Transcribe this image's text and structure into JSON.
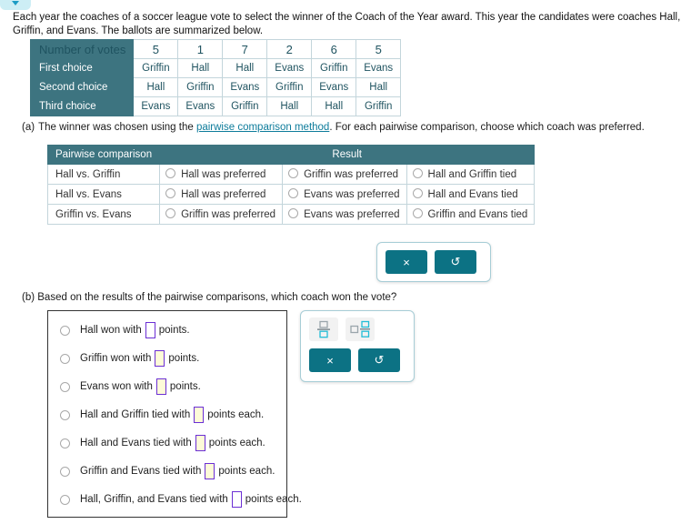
{
  "top_tab": {
    "icon": "chevron-down-icon"
  },
  "intro": "Each year the coaches of a soccer league vote to select the winner of the Coach of the Year award. This year the candidates were coaches Hall, Griffin, and Evans. The ballots are summarized below.",
  "ballot_table": {
    "rows": [
      {
        "label": "Number of votes",
        "cells": [
          "5",
          "1",
          "7",
          "2",
          "6",
          "5"
        ]
      },
      {
        "label": "First choice",
        "cells": [
          "Griffin",
          "Hall",
          "Hall",
          "Evans",
          "Griffin",
          "Evans"
        ]
      },
      {
        "label": "Second choice",
        "cells": [
          "Hall",
          "Griffin",
          "Evans",
          "Griffin",
          "Evans",
          "Hall"
        ]
      },
      {
        "label": "Third choice",
        "cells": [
          "Evans",
          "Evans",
          "Griffin",
          "Hall",
          "Hall",
          "Griffin"
        ]
      }
    ]
  },
  "part_a": {
    "marker": "(a)",
    "text_before": "The winner was chosen using the",
    "link_text": "pairwise comparison method",
    "text_after": ". For each pairwise comparison, choose which coach was preferred.",
    "table": {
      "header_comparison": "Pairwise comparison",
      "header_result": "Result",
      "rows": [
        {
          "comparison": "Hall vs. Griffin",
          "options": [
            "Hall was preferred",
            "Griffin was preferred",
            "Hall and Griffin tied"
          ]
        },
        {
          "comparison": "Hall vs. Evans",
          "options": [
            "Hall was preferred",
            "Evans was preferred",
            "Hall and Evans tied"
          ]
        },
        {
          "comparison": "Griffin vs. Evans",
          "options": [
            "Griffin was preferred",
            "Evans was preferred",
            "Griffin and Evans tied"
          ]
        }
      ]
    },
    "toolbar": {
      "clear_label": "×",
      "undo_label": "↺"
    }
  },
  "part_b": {
    "marker": "(b)",
    "text": "Based on the results of the pairwise comparisons, which coach won the vote?",
    "choices": [
      {
        "before": "Hall won with",
        "box": "",
        "box_filled": false,
        "after": "points."
      },
      {
        "before": "Griffin won with",
        "box": "",
        "box_filled": true,
        "after": "points."
      },
      {
        "before": "Evans won with",
        "box": "",
        "box_filled": true,
        "after": "points."
      },
      {
        "before": "Hall and Griffin tied with",
        "box": "",
        "box_filled": true,
        "after": "points each."
      },
      {
        "before": "Hall and Evans tied with",
        "box": "",
        "box_filled": true,
        "after": "points each."
      },
      {
        "before": "Griffin and Evans tied with",
        "box": "",
        "box_filled": true,
        "after": "points each."
      },
      {
        "before": "Hall, Griffin, and Evans tied with",
        "box": "",
        "box_filled": false,
        "after": "points each."
      }
    ],
    "toolbar": {
      "fraction_icon": "fraction-template-icon",
      "mixed_icon": "mixed-number-template-icon",
      "clear_label": "×",
      "undo_label": "↺"
    }
  },
  "colors": {
    "header_teal": "#3d7480",
    "button_teal": "#0c7284",
    "link_blue": "#0e7c9b",
    "tab_cyan": "#cdeef5",
    "answer_box_border": "#6b2fd4",
    "answer_box_fill": "#fdfbd8"
  }
}
